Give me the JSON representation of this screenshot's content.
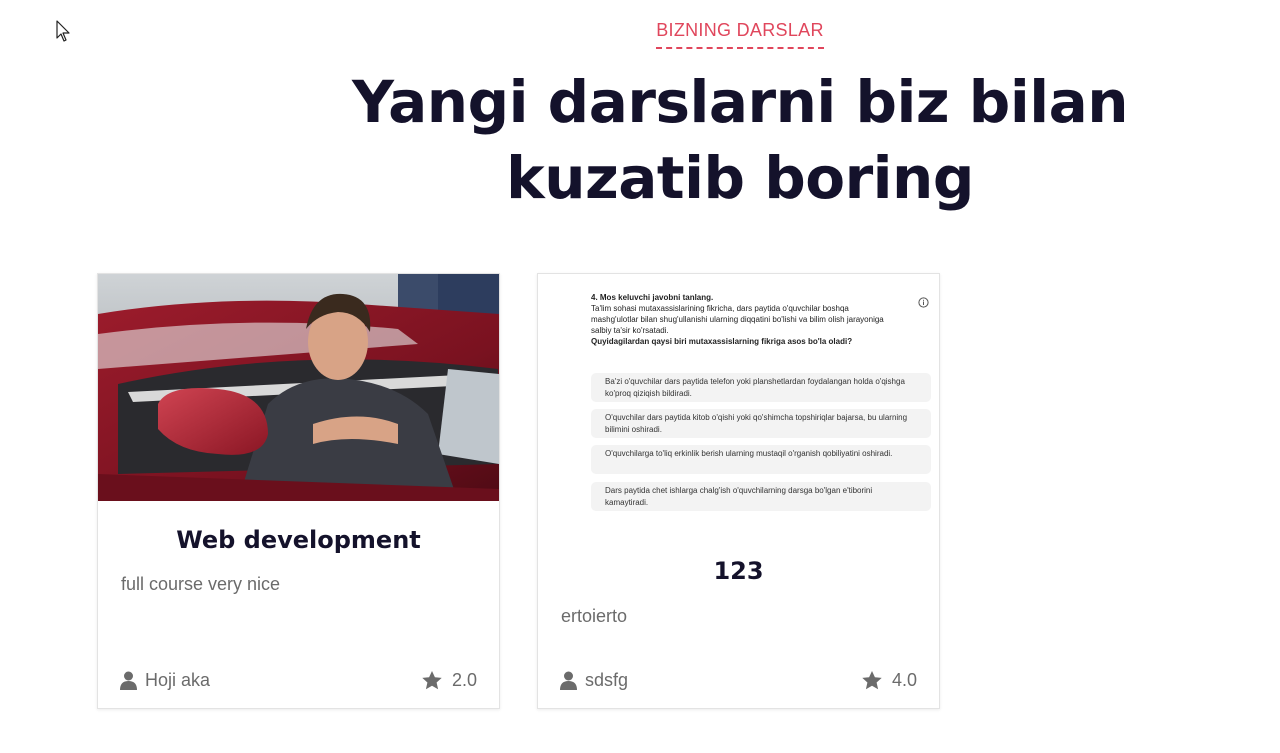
{
  "section": {
    "tag": "BIZNING DARSLAR",
    "heading_line1": "Yangi darslarni biz bilan",
    "heading_line2": "kuzatib boring"
  },
  "courses": [
    {
      "title": "Web development",
      "description": "full course very nice",
      "author": "Hoji aka",
      "rating": "2.0",
      "thumbnail": "photo of a man leaning out of a red car window"
    },
    {
      "title": "123",
      "description": "ertoierto",
      "author": "sdsfg",
      "rating": "4.0",
      "thumbnail": {
        "question_title": "4. Mos keluvchi javobni tanlang.",
        "question_body": "Ta'lim sohasi mutaxassislarining fikricha, dars paytida o'quvchilar boshqa mashg'ulotlar bilan shug'ullanishi ularning diqqatini bo'lishi va bilim olish jarayoniga salbiy ta'sir ko'rsatadi.",
        "question_prompt": "Quyidagilardan qaysi biri mutaxassislarning fikriga asos bo'la oladi?",
        "options": [
          "Ba'zi o'quvchilar dars paytida telefon yoki planshetlardan foydalangan holda o'qishga ko'proq qiziqish bildiradi.",
          "O'quvchilar dars paytida kitob o'qishi yoki qo'shimcha topshiriqlar bajarsa, bu ularning bilimini oshiradi.",
          "O'quvchilarga to'liq erkinlik berish ularning mustaqil o'rganish qobiliyatini oshiradi.",
          "Dars paytida chet ishlarga chalg'ish o'quvchilarning darsga bo'lgan e'tiborini kamaytiradi."
        ]
      }
    }
  ],
  "colors": {
    "accent": "#e0465c",
    "heading": "#14122b",
    "muted": "#6b6b6b"
  },
  "icons": [
    "cursor-icon",
    "user-icon",
    "star-icon",
    "info-icon"
  ]
}
